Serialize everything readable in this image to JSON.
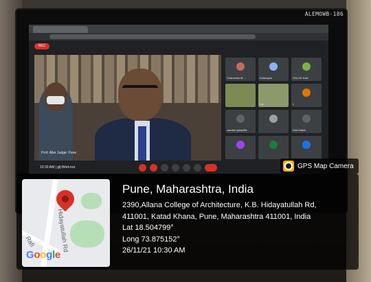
{
  "monitor": {
    "label": "ALEMOWB-186"
  },
  "meeting": {
    "rec_label": "REC",
    "time": "10:30 AM",
    "meeting_id": "| gfj-fbhd-nxx",
    "main_video_caption": "Prof. Aller Judge: Pune",
    "participants": [
      {
        "name": "Chamnsilu M...",
        "kind": "avatar",
        "color": "#c26b5b"
      },
      {
        "name": "Kalarayan",
        "kind": "avatar",
        "color": "#8ab4f8"
      },
      {
        "name": "GALCK Kale",
        "kind": "avatar",
        "color": "#7cb342"
      },
      {
        "name": "",
        "kind": "camera",
        "color": "#7d8a55"
      },
      {
        "name": "Kar",
        "kind": "camera",
        "color": "#8a9a6a"
      },
      {
        "name": "L",
        "kind": "avatar",
        "color": "#e37400"
      },
      {
        "name": "vandan ganpatle",
        "kind": "avatar",
        "color": "#5f6368"
      },
      {
        "name": "",
        "kind": "avatar",
        "color": "#9aa0a6"
      },
      {
        "name": "Dial Dialsh",
        "kind": "avatar",
        "color": "#5f6368"
      },
      {
        "name": "",
        "kind": "avatar",
        "color": "#a142f4"
      },
      {
        "name": "",
        "kind": "avatar",
        "color": "#188038"
      },
      {
        "name": "",
        "kind": "avatar",
        "color": "#1a73e8"
      }
    ],
    "controls": [
      "mic-off",
      "camera-off",
      "captions",
      "present",
      "raise-hand",
      "more",
      "end-call"
    ]
  },
  "overlay": {
    "brand": "GPS Map Camera",
    "title": "Pune, Maharashtra, India",
    "address_line1": "2390,Allana College of Architecture, K.B. Hidayatullah Rd,",
    "address_line2": "411001, Katad Khana, Pune, Maharashtra 411001, India",
    "lat": "Lat 18.504799°",
    "long": "Long 73.875152°",
    "datetime": "26/11/21 10:30 AM"
  },
  "map": {
    "street_a": "Hidayatullah Rd",
    "street_b": "Rafi",
    "logo": "Google",
    "logo_colors": [
      "#4285F4",
      "#EA4335",
      "#FBBC05",
      "#4285F4",
      "#34A853",
      "#EA4335"
    ],
    "pin_color": "#d93025"
  }
}
